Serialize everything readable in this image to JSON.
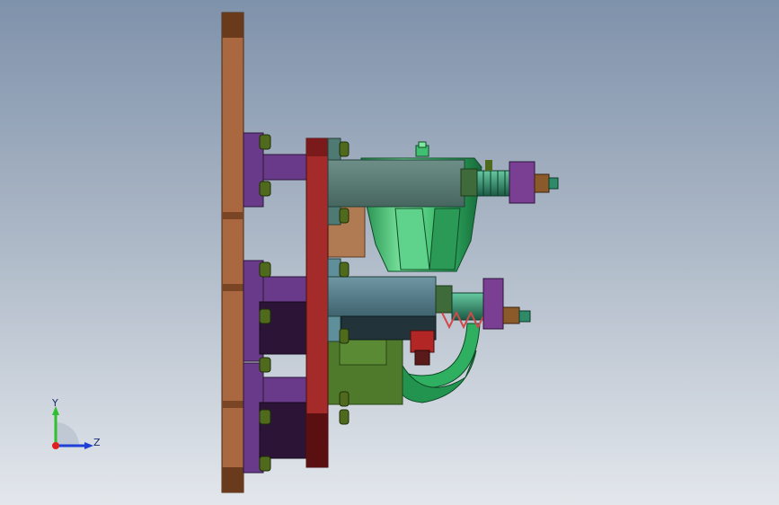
{
  "viewport": {
    "background_top": "#7f92ab",
    "background_bottom": "#e3e7ec"
  },
  "triad": {
    "y_label": "Y",
    "z_label": "Z",
    "y_color": "#2fbf2f",
    "z_color": "#1f3fd6",
    "x_color": "#e02020"
  },
  "part_colors": {
    "base_plate": "#a9683f",
    "clamp_plate": "#a52a2a",
    "bracket": "#6a3a8a",
    "block_dark": "#2b1435",
    "arm": "#4f7a73",
    "housing": "#2fa85a",
    "bolt": "#4f6a1c",
    "spring": "#2f6f58",
    "stop_block": "#7a3f92",
    "olive_block": "#4f7a2b",
    "red_tab": "#b32626"
  }
}
